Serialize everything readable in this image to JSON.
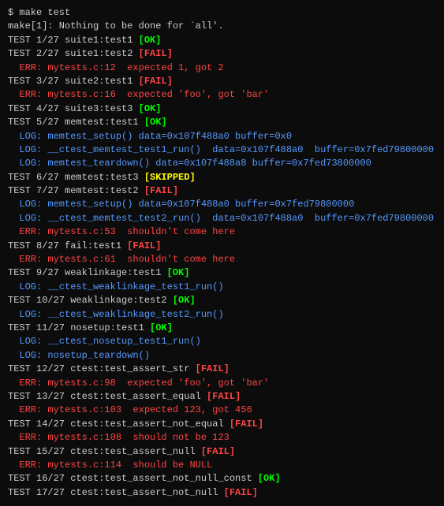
{
  "terminal": {
    "prompt": "$ make test",
    "lines": [
      {
        "id": "make-output",
        "text": "make[1]: Nothing to be done for `all'.",
        "color": "white"
      },
      {
        "id": "test-1",
        "parts": [
          {
            "text": "TEST 1/27 suite1:test1 ",
            "color": "white"
          },
          {
            "text": "[OK]",
            "color": "ok"
          }
        ]
      },
      {
        "id": "test-2",
        "parts": [
          {
            "text": "TEST 2/27 suite1:test2 ",
            "color": "white"
          },
          {
            "text": "[FAIL]",
            "color": "fail"
          }
        ]
      },
      {
        "id": "test-2-err",
        "parts": [
          {
            "text": "  ERR: mytests.c:12  expected 1, got 2",
            "color": "err"
          }
        ]
      },
      {
        "id": "test-3",
        "parts": [
          {
            "text": "TEST 3/27 suite2:test1 ",
            "color": "white"
          },
          {
            "text": "[FAIL]",
            "color": "fail"
          }
        ]
      },
      {
        "id": "test-3-err",
        "parts": [
          {
            "text": "  ERR: mytests.c:16  expected 'foo', got 'bar'",
            "color": "err"
          }
        ]
      },
      {
        "id": "test-4",
        "parts": [
          {
            "text": "TEST 4/27 suite3:test3 ",
            "color": "white"
          },
          {
            "text": "[OK]",
            "color": "ok"
          }
        ]
      },
      {
        "id": "test-5",
        "parts": [
          {
            "text": "TEST 5/27 memtest:test1 ",
            "color": "white"
          },
          {
            "text": "[OK]",
            "color": "ok"
          }
        ]
      },
      {
        "id": "test-5-log1",
        "parts": [
          {
            "text": "  LOG: memtest_setup() data=0x107f488a0 buffer=0x0",
            "color": "log"
          }
        ]
      },
      {
        "id": "test-5-log2",
        "parts": [
          {
            "text": "  LOG: __ctest_memtest_test1_run()  data=0x107f488a0  buffer=0x7fed79800000",
            "color": "log"
          }
        ]
      },
      {
        "id": "test-5-log3",
        "parts": [
          {
            "text": "  LOG: memtest_teardown() data=0x107f488a8 buffer=0x7fed73800000",
            "color": "log"
          }
        ]
      },
      {
        "id": "test-6",
        "parts": [
          {
            "text": "TEST 6/27 memtest:test3 ",
            "color": "white"
          },
          {
            "text": "[SKIPPED]",
            "color": "skipped"
          }
        ]
      },
      {
        "id": "test-7",
        "parts": [
          {
            "text": "TEST 7/27 memtest:test2 ",
            "color": "white"
          },
          {
            "text": "[FAIL]",
            "color": "fail"
          }
        ]
      },
      {
        "id": "test-7-log1",
        "parts": [
          {
            "text": "  LOG: memtest_setup() data=0x107f488a0 buffer=0x7fed79800000",
            "color": "log"
          }
        ]
      },
      {
        "id": "test-7-log2",
        "parts": [
          {
            "text": "  LOG: __ctest_memtest_test2_run()  data=0x107f488a0  buffer=0x7fed79800000",
            "color": "log"
          }
        ]
      },
      {
        "id": "test-7-err",
        "parts": [
          {
            "text": "  ERR: mytests.c:53  shouldn't come here",
            "color": "err"
          }
        ]
      },
      {
        "id": "test-8",
        "parts": [
          {
            "text": "TEST 8/27 fail:test1 ",
            "color": "white"
          },
          {
            "text": "[FAIL]",
            "color": "fail"
          }
        ]
      },
      {
        "id": "test-8-err",
        "parts": [
          {
            "text": "  ERR: mytests.c:61  shouldn't come here",
            "color": "err"
          }
        ]
      },
      {
        "id": "test-9",
        "parts": [
          {
            "text": "TEST 9/27 weaklinkage:test1 ",
            "color": "white"
          },
          {
            "text": "[OK]",
            "color": "ok"
          }
        ]
      },
      {
        "id": "test-9-log1",
        "parts": [
          {
            "text": "  LOG: __ctest_weaklinkage_test1_run()",
            "color": "log"
          }
        ]
      },
      {
        "id": "test-10",
        "parts": [
          {
            "text": "TEST 10/27 weaklinkage:test2 ",
            "color": "white"
          },
          {
            "text": "[OK]",
            "color": "ok"
          }
        ]
      },
      {
        "id": "test-10-log1",
        "parts": [
          {
            "text": "  LOG: __ctest_weaklinkage_test2_run()",
            "color": "log"
          }
        ]
      },
      {
        "id": "test-11",
        "parts": [
          {
            "text": "TEST 11/27 nosetup:test1 ",
            "color": "white"
          },
          {
            "text": "[OK]",
            "color": "ok"
          }
        ]
      },
      {
        "id": "test-11-log1",
        "parts": [
          {
            "text": "  LOG: __ctest_nosetup_test1_run()",
            "color": "log"
          }
        ]
      },
      {
        "id": "test-11-log2",
        "parts": [
          {
            "text": "  LOG: nosetup_teardown()",
            "color": "log"
          }
        ]
      },
      {
        "id": "test-12",
        "parts": [
          {
            "text": "TEST 12/27 ctest:test_assert_str ",
            "color": "white"
          },
          {
            "text": "[FAIL]",
            "color": "fail"
          }
        ]
      },
      {
        "id": "test-12-err",
        "parts": [
          {
            "text": "  ERR: mytests.c:98  expected 'foo', got 'bar'",
            "color": "err"
          }
        ]
      },
      {
        "id": "test-13",
        "parts": [
          {
            "text": "TEST 13/27 ctest:test_assert_equal ",
            "color": "white"
          },
          {
            "text": "[FAIL]",
            "color": "fail"
          }
        ]
      },
      {
        "id": "test-13-err",
        "parts": [
          {
            "text": "  ERR: mytests.c:103  expected 123, got 456",
            "color": "err"
          }
        ]
      },
      {
        "id": "test-14",
        "parts": [
          {
            "text": "TEST 14/27 ctest:test_assert_not_equal ",
            "color": "white"
          },
          {
            "text": "[FAIL]",
            "color": "fail"
          }
        ]
      },
      {
        "id": "test-14-err",
        "parts": [
          {
            "text": "  ERR: mytests.c:108  should not be 123",
            "color": "err"
          }
        ]
      },
      {
        "id": "test-15",
        "parts": [
          {
            "text": "TEST 15/27 ctest:test_assert_null ",
            "color": "white"
          },
          {
            "text": "[FAIL]",
            "color": "fail"
          }
        ]
      },
      {
        "id": "test-15-err",
        "parts": [
          {
            "text": "  ERR: mytests.c:114  should be NULL",
            "color": "err"
          }
        ]
      },
      {
        "id": "test-16",
        "parts": [
          {
            "text": "TEST 16/27 ctest:test_assert_not_null_const ",
            "color": "white"
          },
          {
            "text": "[OK]",
            "color": "ok"
          }
        ]
      },
      {
        "id": "test-17",
        "parts": [
          {
            "text": "TEST 17/27 ctest:test_assert_not_null ",
            "color": "white"
          },
          {
            "text": "[FAIL]",
            "color": "fail"
          }
        ]
      }
    ]
  }
}
